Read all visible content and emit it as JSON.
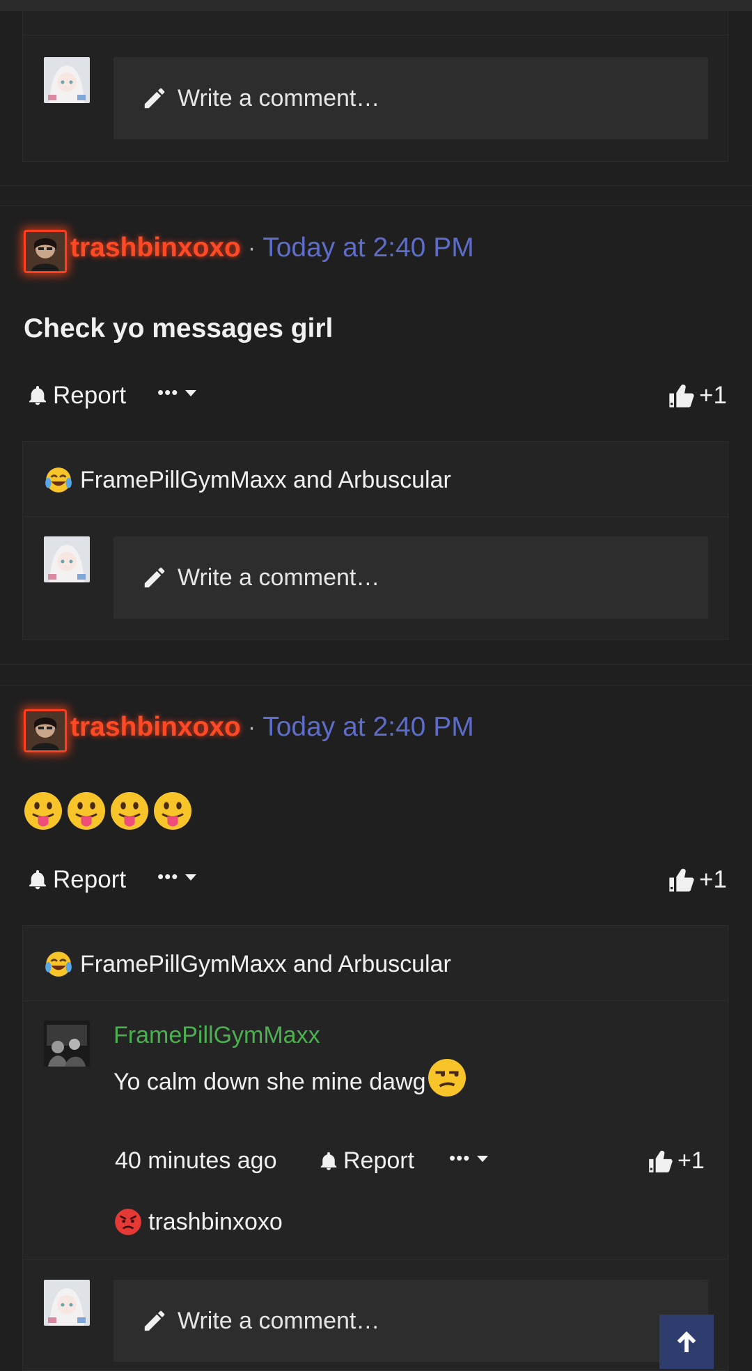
{
  "comment_placeholder": "Write a comment…",
  "posts": [
    {
      "username": "trashbinxoxo",
      "separator": "·",
      "time": "Today at 2:40 PM",
      "message": "Check yo messages girl",
      "report_label": "Report",
      "more_label": "•••",
      "like_count": "+1",
      "reaction_users": "FramePillGymMaxx and Arbuscular"
    },
    {
      "username": "trashbinxoxo",
      "separator": "·",
      "time": "Today at 2:40 PM",
      "message_emoji": "😛😛😛😛",
      "report_label": "Report",
      "more_label": "•••",
      "like_count": "+1",
      "reaction_users": "FramePillGymMaxx and Arbuscular",
      "reply": {
        "author": "FramePillGymMaxx",
        "text": "Yo calm down she mine dawg",
        "time": "40 minutes ago",
        "report_label": "Report",
        "more_label": "•••",
        "like_count": "+1",
        "reaction_user": "trashbinxoxo"
      }
    }
  ],
  "colors": {
    "background": "#1f1f20",
    "username": "#ff4a26",
    "timestamp": "#5d6dc9",
    "reply_author": "#4caf50",
    "scroll_button": "#2e3d6e"
  }
}
